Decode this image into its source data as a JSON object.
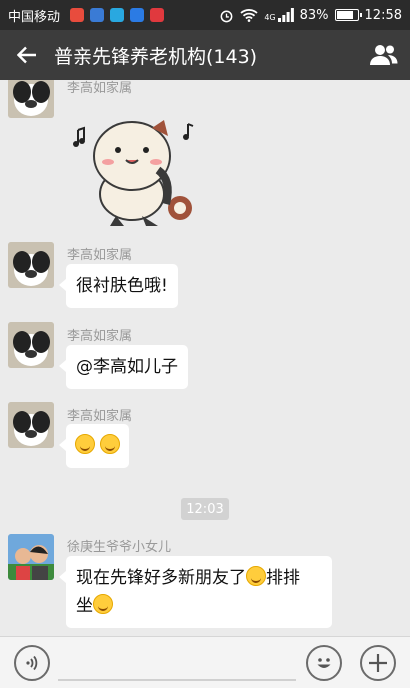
{
  "status_bar": {
    "carrier": "中国移动",
    "network": "4G",
    "battery": "83%",
    "battery_level": 0.83,
    "time": "12:58",
    "app_icon_colors": [
      "#e84c3d",
      "#3a7bd5",
      "#29a8e0",
      "#2b7be4",
      "#e0393e"
    ]
  },
  "header": {
    "back_icon": "back-arrow-icon",
    "title": "普亲先锋养老机构(143)",
    "group_icon": "group-members-icon"
  },
  "messages": [
    {
      "sender": "李高如家属",
      "type": "sticker",
      "sticker": "panda-cat-sticker"
    },
    {
      "sender": "李高如家属",
      "type": "text",
      "text": "很衬肤色哦!"
    },
    {
      "sender": "李高如家属",
      "type": "text",
      "text": "@李高如儿子"
    },
    {
      "sender": "李高如家属",
      "type": "emoji",
      "emoji": [
        "grimace-emoji",
        "grimace-emoji"
      ]
    }
  ],
  "timestamp": "12:03",
  "last_message": {
    "sender": "徐庚生爷爷小女儿",
    "line1": "现在先锋好多新朋友了",
    "line1_end": "排排",
    "line2": "坐"
  },
  "input_bar": {
    "voice_icon": "voice-icon",
    "emoji_icon": "emoji-icon",
    "plus_icon": "plus-icon"
  },
  "colors": {
    "status_bar": "#2b2b2b",
    "header": "#3c3c3c",
    "chat_bg": "#ebebeb",
    "bubble": "#ffffff"
  }
}
